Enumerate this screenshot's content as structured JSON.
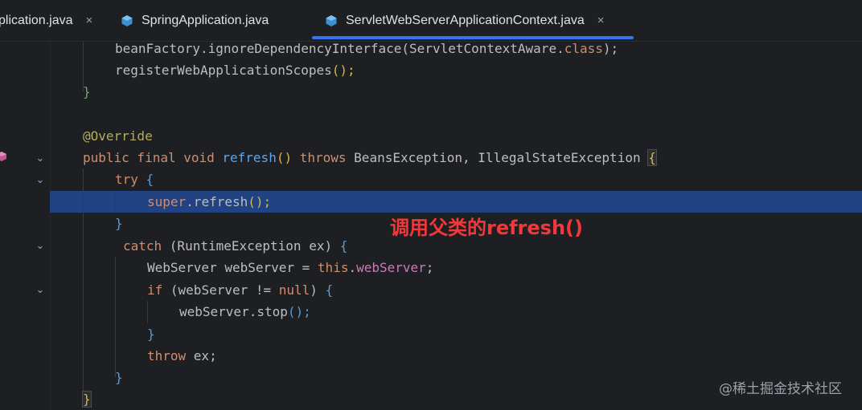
{
  "tabs": [
    {
      "label": "plication.java",
      "close": "×",
      "icon": "none"
    },
    {
      "label": "SpringApplication.java",
      "close": "",
      "icon": "java-class-icon"
    },
    {
      "label": "ServletWebServerApplicationContext.java",
      "close": "×",
      "icon": "java-class-icon",
      "active": true
    }
  ],
  "code": {
    "l1": {
      "a": "beanFactory.ignoreDependencyInterface(",
      "b": "ServletContextAware.",
      "c": "class",
      "d": ");"
    },
    "l2": {
      "a": "registerWebApplicationScopes",
      "b": "();"
    },
    "l3": {
      "a": "}"
    },
    "l5": {
      "a": "@Override"
    },
    "l6": {
      "a": "public final void ",
      "b": "refresh",
      "c": "() ",
      "d": "throws ",
      "e": "BeansException, IllegalStateException ",
      "f": "{"
    },
    "l7": {
      "a": "try ",
      "b": "{"
    },
    "l8": {
      "a": "super",
      "b": ".refresh",
      "c": "();"
    },
    "l9": {
      "a": "}"
    },
    "l10": {
      "a": "catch ",
      "b": "(RuntimeException ex) ",
      "c": "{"
    },
    "l11": {
      "a": "WebServer webServer = ",
      "b": "this",
      "c": ".",
      "d": "webServer",
      "e": ";"
    },
    "l12": {
      "a": "if ",
      "b": "(webServer != ",
      "c": "null",
      "d": ") ",
      "e": "{"
    },
    "l13": {
      "a": "webServer.stop",
      "b": "();"
    },
    "l14": {
      "a": "}"
    },
    "l15": {
      "a": "throw ",
      "b": "ex;"
    },
    "l16": {
      "a": "}"
    },
    "l17": {
      "a": "}"
    }
  },
  "annotation": "调用父类的refresh()",
  "watermark": "@稀土掘金技术社区",
  "colors": {
    "background": "#1e1f22",
    "selection": "#214283",
    "keyword": "#cf8e6d",
    "function": "#56a8f5",
    "annotation_red": "#f2383a",
    "tab_active_underline": "#3574f0"
  }
}
